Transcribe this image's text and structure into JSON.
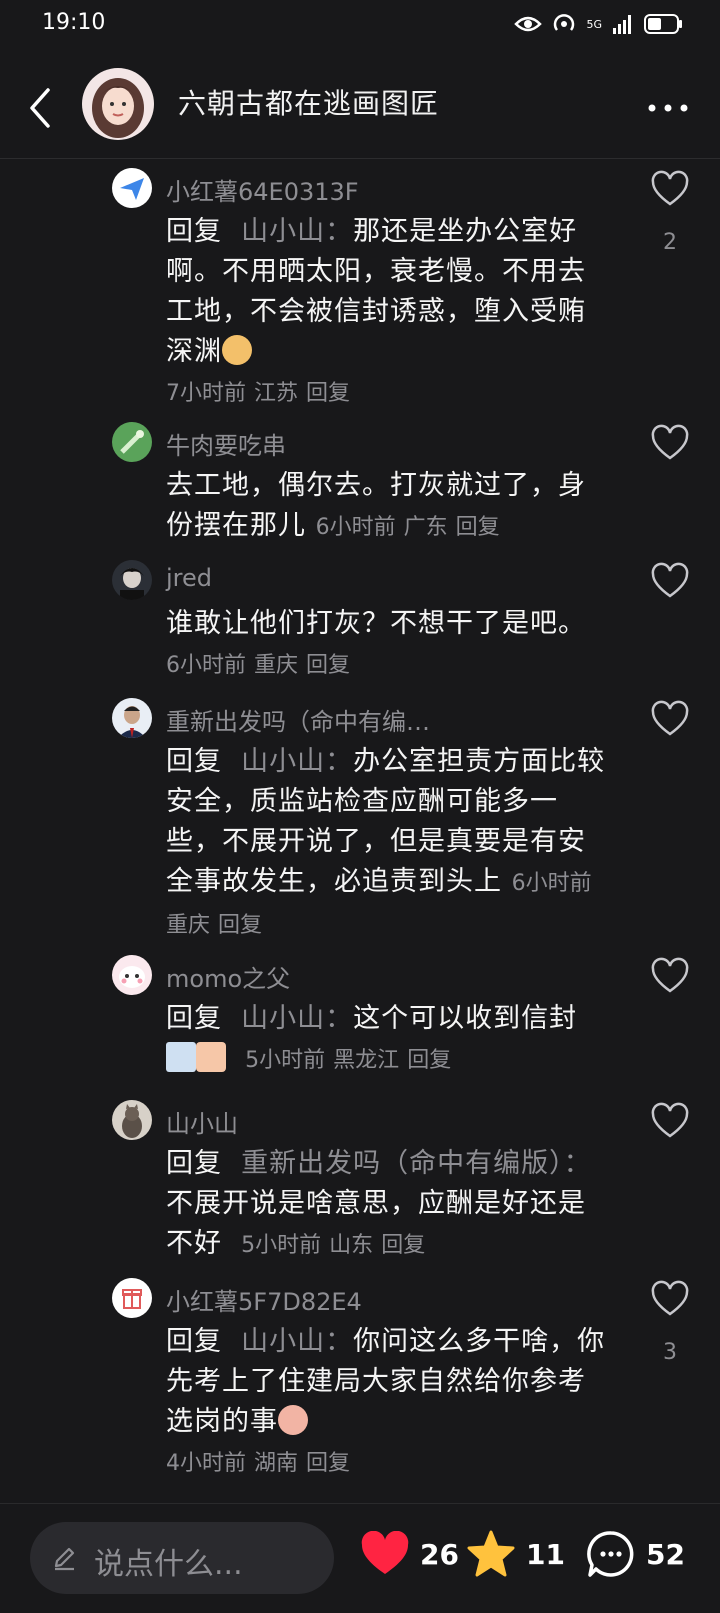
{
  "status": {
    "time": "19:10",
    "net": "5G"
  },
  "header": {
    "author": "六朝古都在逃画图匠"
  },
  "comments": [
    {
      "name": "小红薯64E0313F",
      "reply_label": "回复",
      "reply_to": "山小山：",
      "text_line1": "那还是坐办公室",
      "text_rest": "好啊。不用晒太阳，衰老慢。不用去工地，不会被信封诱惑，堕入受贿深渊",
      "time": "7小时前",
      "location": "江苏",
      "reply": "回复",
      "likes": "2"
    },
    {
      "name": "牛肉要吃串",
      "text": "去工地，偶尔去。打灰就过了，身份摆在那儿",
      "time": "6小时前",
      "location": "广东",
      "reply": "回复"
    },
    {
      "name": "jred",
      "text": "谁敢让他们打灰？不想干了是吧。",
      "time": "6小时前",
      "location": "重庆",
      "reply": "回复"
    },
    {
      "name": "重新出发吗（命中有编…",
      "reply_label": "回复",
      "reply_to": "山小山：",
      "text_line1": "办公室担责方面",
      "text_rest": "比较安全，质监站检查应酬可能多一些，不展开说了，但是真要是有安全事故发生，必追责到头上",
      "time": "6小时前",
      "location": "重庆",
      "reply": "回复"
    },
    {
      "name": "momo之父",
      "reply_label": "回复",
      "reply_to": "山小山：",
      "text_line1": "这个可以收到信",
      "text_rest": "封",
      "time": "5小时前",
      "location": "黑龙江",
      "reply": "回复"
    },
    {
      "name": "山小山",
      "reply_label": "回复",
      "reply_to": "重新出发吗（命中有编版）：",
      "text": "不展开说是啥意思，应酬是好还是不好",
      "time": "5小时前",
      "location": "山东",
      "reply": "回复"
    },
    {
      "name": "小红薯5F7D82E4",
      "reply_label": "回复",
      "reply_to": "山小山：",
      "text_line1": "你问这么多干",
      "text_rest": "啥，你先考上了住建局大家自然给你参考选岗的事",
      "time": "4小时前",
      "location": "湖南",
      "reply": "回复",
      "likes": "3"
    }
  ],
  "bottom": {
    "placeholder": "说点什么...",
    "likes": "26",
    "favorites": "11",
    "comments": "52"
  },
  "colors": {
    "like_red": "#ff2442",
    "star_yellow": "#ffc23d",
    "muted": "#8e8e93"
  },
  "icons": [
    "back-icon",
    "more-icon",
    "heart-icon",
    "star-icon",
    "comment-icon",
    "pen-icon"
  ]
}
